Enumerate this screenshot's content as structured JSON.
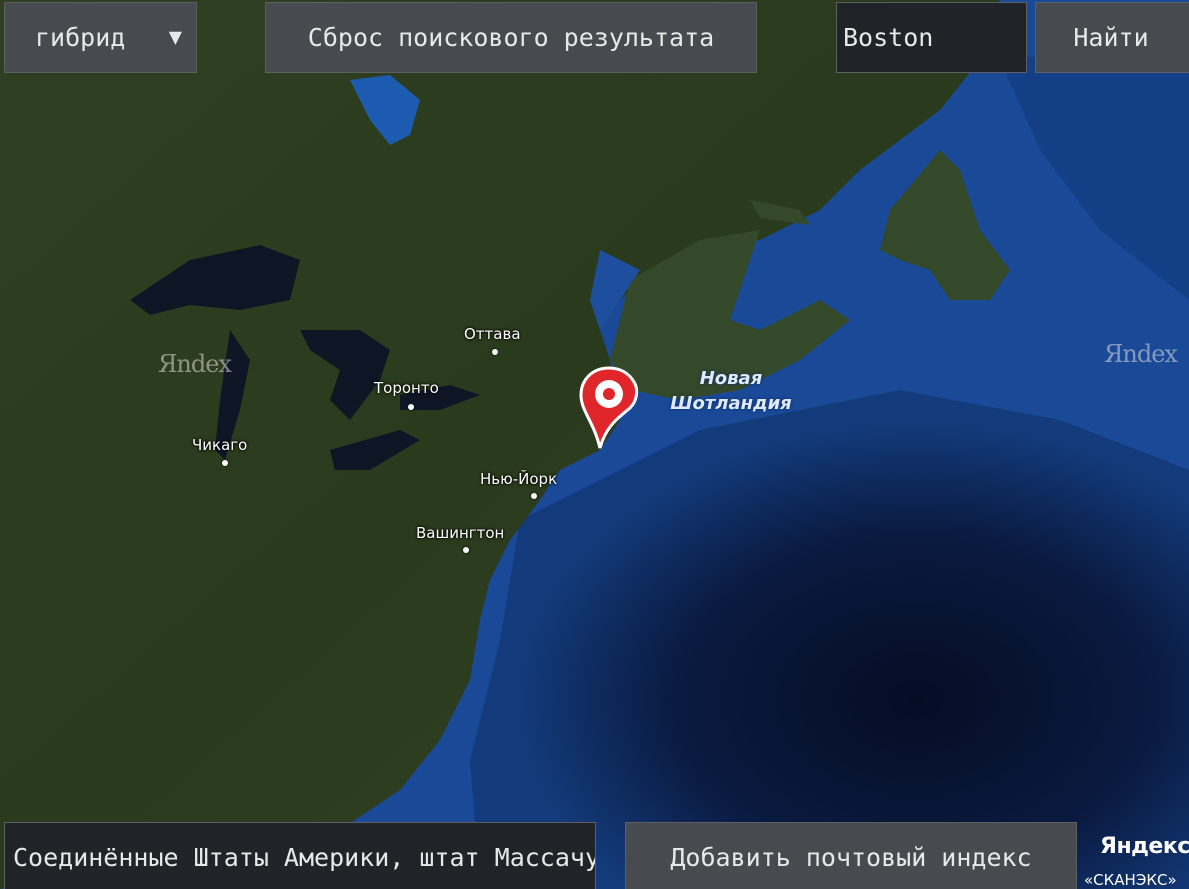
{
  "toolbar": {
    "map_type": "гибрид",
    "reset_label": "Сброс поискового результата",
    "search_value": "Boston",
    "find_label": "Найти"
  },
  "bottom_bar": {
    "address_value": "Соединённые Штаты Америки, штат Массачусетс",
    "postal_label": "Добавить почтовый индекс"
  },
  "map": {
    "cities": [
      "Оттава",
      "Торонто",
      "Чикаго",
      "Нью-Йорк",
      "Вашингтон"
    ],
    "region_line1": "Новая",
    "region_line2": "Шотландия",
    "watermark": "Яndex",
    "copyright_brand": "Яндекс",
    "copyright_sub": "«СКАНЭКС»",
    "marker_color": "#e0252b",
    "land_color": "#2b3a1e",
    "water_color": "#1c4f9c"
  }
}
